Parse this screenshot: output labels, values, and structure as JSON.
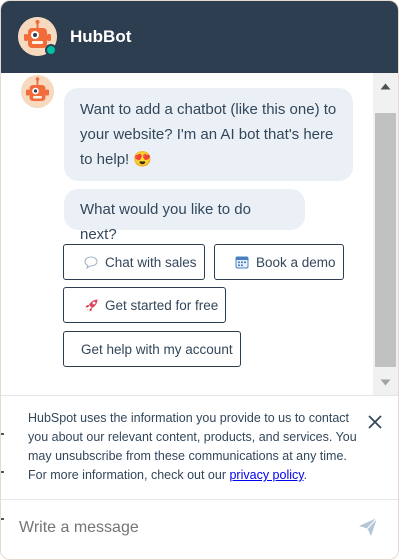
{
  "header": {
    "title": "HubBot",
    "avatar_icon": "robot-icon",
    "status_color": "#00bda5"
  },
  "messages": {
    "bot_1": "Want to add a chatbot (like this one) to your website? I'm an AI bot that's here to help! 😍",
    "bot_2": "What would you like to do next?"
  },
  "quick_replies": [
    {
      "label": "Chat with sales",
      "icon": "speech-bubble-icon"
    },
    {
      "label": "Book a demo",
      "icon": "calendar-icon"
    },
    {
      "label": "Get started for free",
      "icon": "rocket-icon"
    },
    {
      "label": "Get help with my account",
      "icon": ""
    }
  ],
  "disclaimer": {
    "text": "HubSpot uses the information you provide to us to contact you about our relevant content, products, and services. You may unsubscribe from these communications at any time. For more information, check out our ",
    "link_text": "privacy policy",
    "suffix": "."
  },
  "composer": {
    "placeholder": "Write a message"
  },
  "colors": {
    "header_bg": "#2d3e50",
    "bubble_bg": "#eaf0f6",
    "text": "#33475b",
    "link": "#0000ee"
  }
}
